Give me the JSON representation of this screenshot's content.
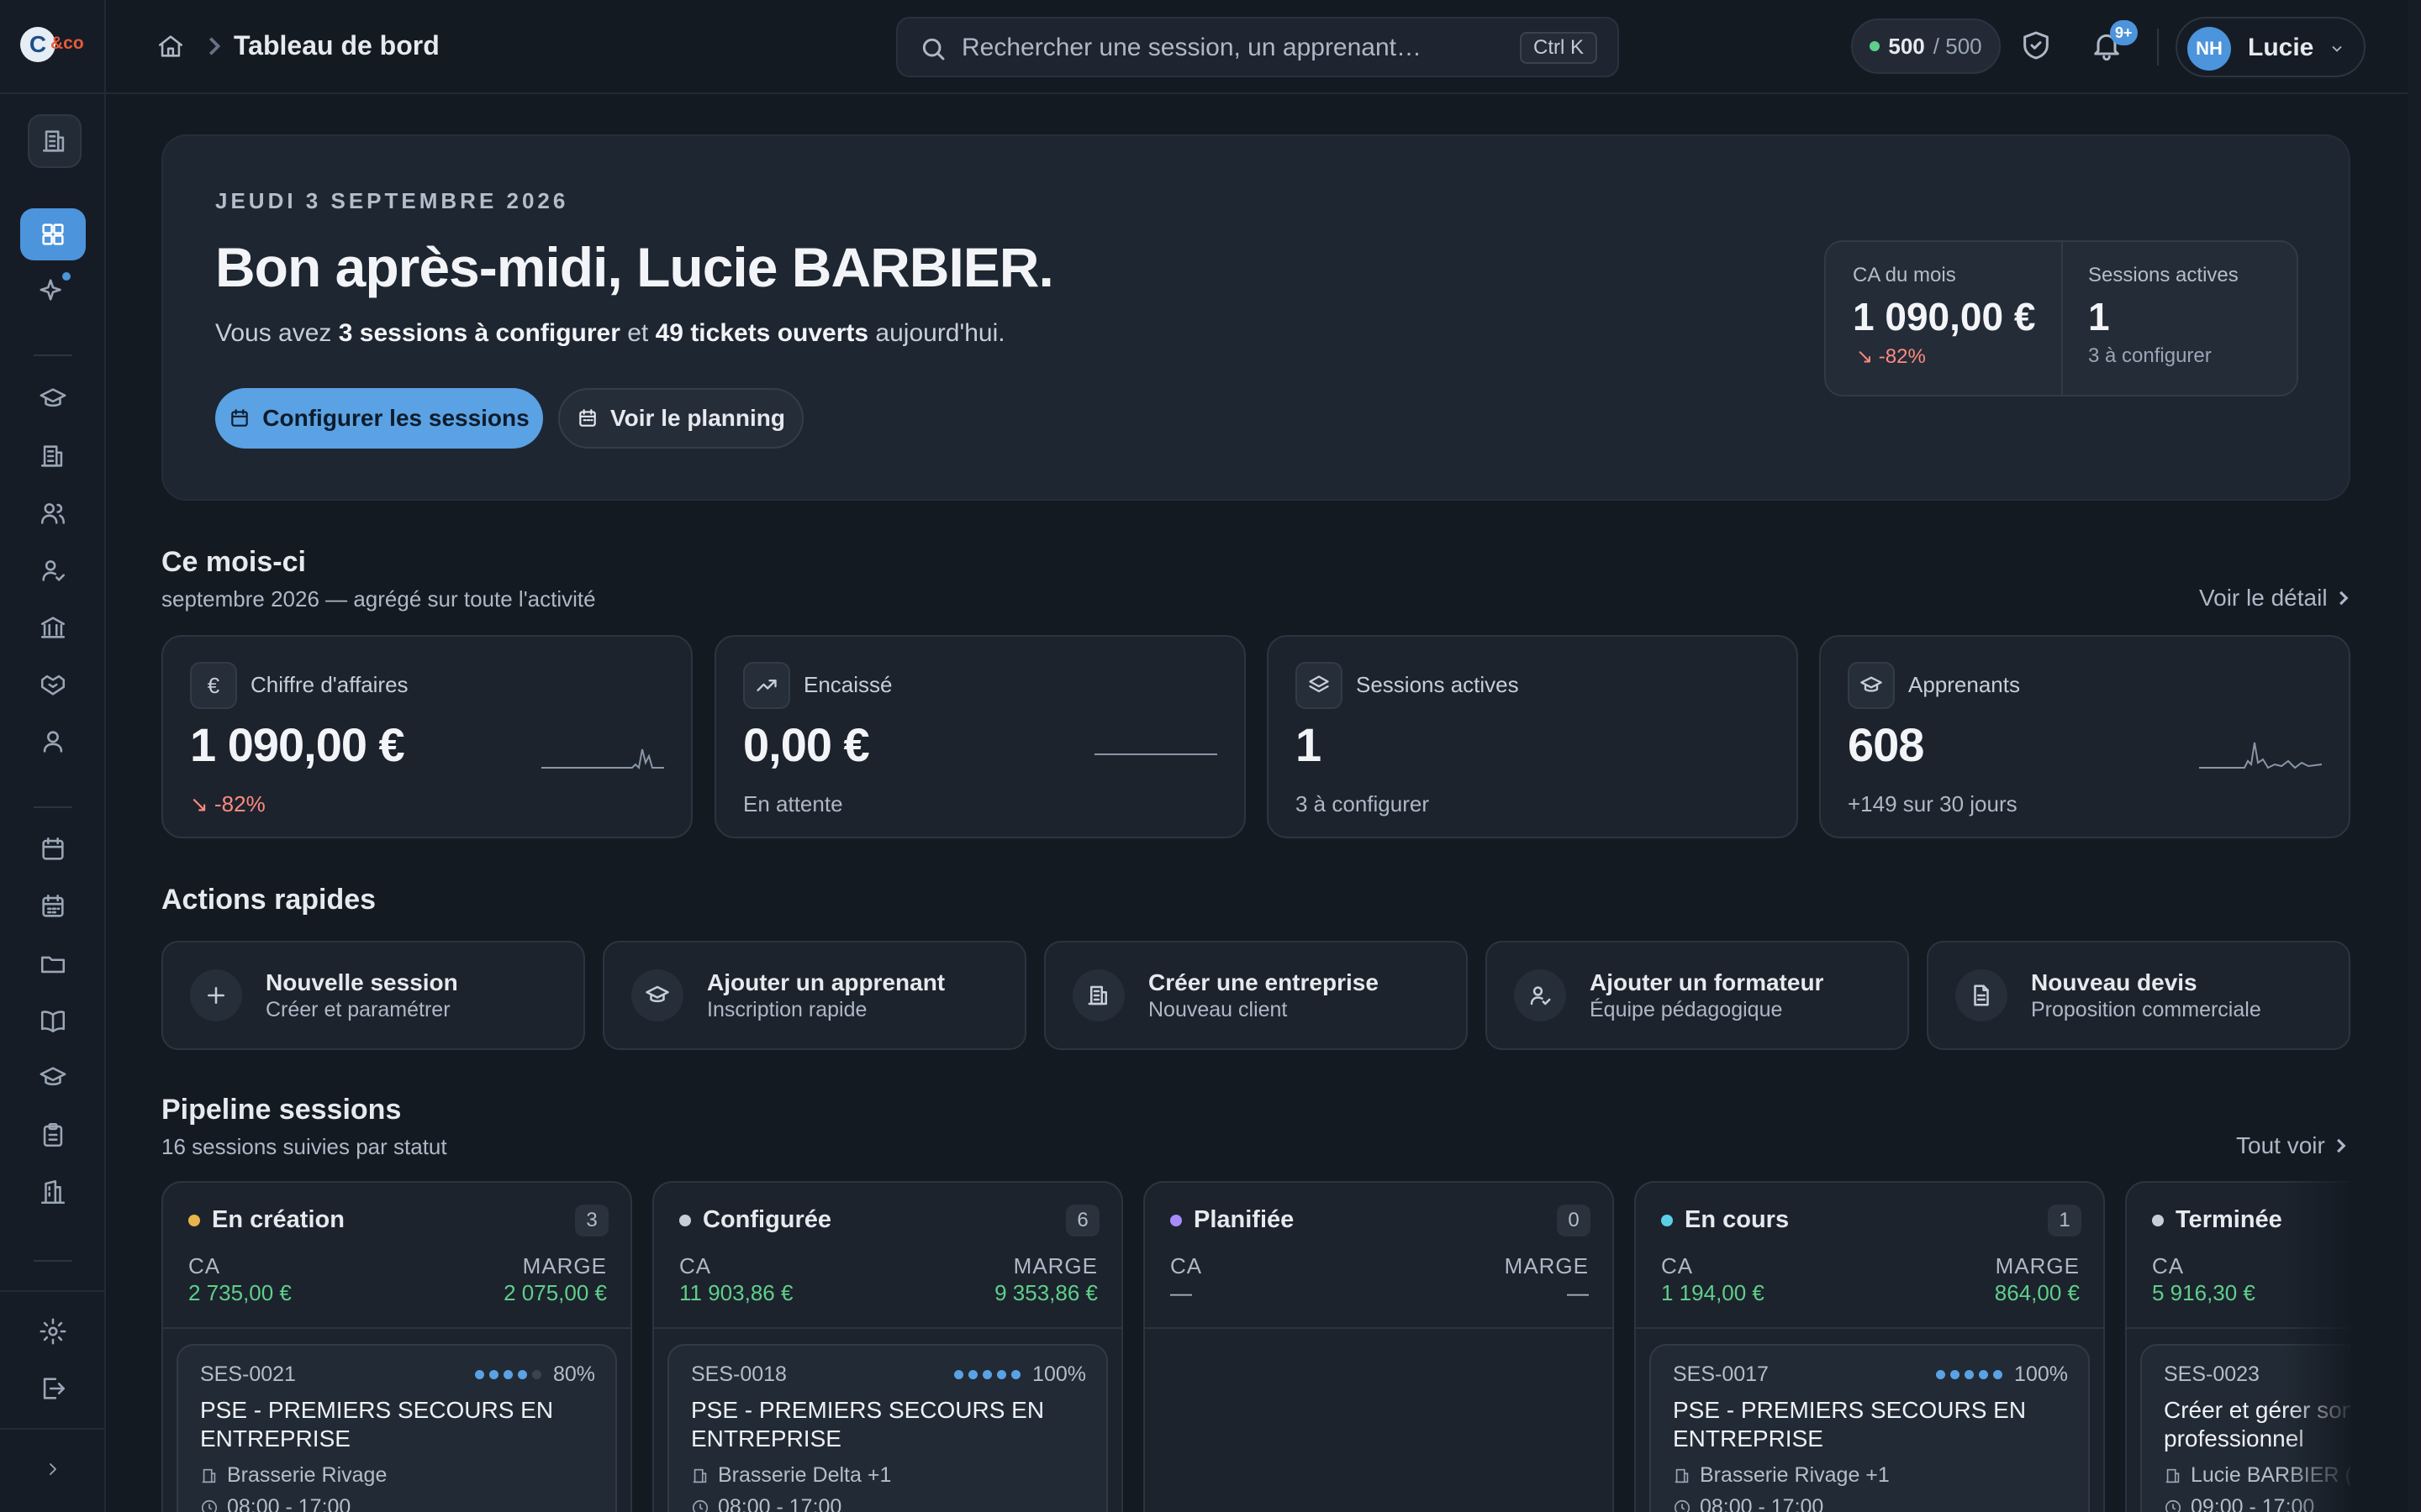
{
  "app": {
    "logo_letter": "C",
    "logo_suffix": "&co"
  },
  "topbar": {
    "breadcrumb_title": "Tableau de bord",
    "search_placeholder": "Rechercher une session, un apprenant…",
    "search_shortcut": "Ctrl K",
    "credits_used": "500",
    "credits_total": "/ 500",
    "notifications_badge": "9+",
    "user_initials": "NH",
    "user_name": "Lucie"
  },
  "hero": {
    "date": "JEUDI 3 SEPTEMBRE 2026",
    "greeting": "Bon après-midi, Lucie BARBIER.",
    "sub_prefix": "Vous avez ",
    "sub_bold1": "3 sessions à configurer",
    "sub_mid": " et ",
    "sub_bold2": "49 tickets ouverts",
    "sub_suffix": " aujourd'hui.",
    "btn_configure": "Configurer les sessions",
    "btn_planning": "Voir le planning",
    "stats": {
      "ca_label": "CA du mois",
      "ca_value": "1 090,00 €",
      "ca_trend": "↘ -82%",
      "sessions_label": "Sessions actives",
      "sessions_value": "1",
      "sessions_note": "3 à configurer"
    }
  },
  "month": {
    "title": "Ce mois-ci",
    "subtitle": "septembre 2026 — agrégé sur toute l'activité",
    "link": "Voir le détail",
    "kpis": [
      {
        "icon": "euro-icon",
        "glyph": "€",
        "label": "Chiffre d'affaires",
        "value": "1 090,00 €",
        "note": "↘ -82%"
      },
      {
        "icon": "trending-up-icon",
        "label": "Encaissé",
        "value": "0,00 €",
        "note": "En attente"
      },
      {
        "icon": "layers-icon",
        "label": "Sessions actives",
        "value": "1",
        "note": "3 à configurer"
      },
      {
        "icon": "graduation-cap-icon",
        "label": "Apprenants",
        "value": "608",
        "note": "+149 sur 30 jours"
      }
    ]
  },
  "quick_actions": {
    "title": "Actions rapides",
    "items": [
      {
        "icon": "plus-icon",
        "title": "Nouvelle session",
        "sub": "Créer et paramétrer"
      },
      {
        "icon": "graduation-cap-icon",
        "title": "Ajouter un apprenant",
        "sub": "Inscription rapide"
      },
      {
        "icon": "building-icon",
        "title": "Créer une entreprise",
        "sub": "Nouveau client"
      },
      {
        "icon": "user-check-icon",
        "title": "Ajouter un formateur",
        "sub": "Équipe pédagogique"
      },
      {
        "icon": "document-icon",
        "title": "Nouveau devis",
        "sub": "Proposition commerciale"
      }
    ]
  },
  "pipeline": {
    "title": "Pipeline sessions",
    "subtitle": "16 sessions suivies par statut",
    "link": "Tout voir",
    "ca_label": "CA",
    "marge_label": "MARGE",
    "columns": [
      {
        "name": "En création",
        "color": "#e8b44c",
        "count": "3",
        "ca": "2 735,00 €",
        "marge": "2 075,00 €",
        "card": {
          "ref": "SES-0021",
          "progress": 0.8,
          "progress_label": "80%",
          "title": "PSE - PREMIERS SECOURS EN ENTREPRISE",
          "org": "Brasserie Rivage",
          "time": "08:00 - 17:00"
        }
      },
      {
        "name": "Configurée",
        "color": "#c7ced9",
        "count": "6",
        "ca": "11 903,86 €",
        "marge": "9 353,86 €",
        "card": {
          "ref": "SES-0018",
          "progress": 1.0,
          "progress_label": "100%",
          "title": "PSE - PREMIERS SECOURS EN ENTREPRISE",
          "org": "Brasserie Delta  +1",
          "time": "08:00 - 17:00"
        }
      },
      {
        "name": "Planifiée",
        "color": "#a78bfa",
        "count": "0",
        "ca": "—",
        "marge": "—",
        "card": null
      },
      {
        "name": "En cours",
        "color": "#5ad0e8",
        "count": "1",
        "ca": "1 194,00 €",
        "marge": "864,00 €",
        "card": {
          "ref": "SES-0017",
          "progress": 1.0,
          "progress_label": "100%",
          "title": "PSE - PREMIERS SECOURS EN ENTREPRISE",
          "org": "Brasserie Rivage  +1",
          "time": "08:00 - 17:00"
        }
      },
      {
        "name": "Terminée",
        "color": "#c7ced9",
        "count": "",
        "ca": "5 916,30 €",
        "marge": "",
        "card": {
          "ref": "SES-0023",
          "progress": null,
          "progress_label": "",
          "title": "Créer et gérer son professionnel",
          "org": "Lucie BARBIER (",
          "time": "09:00 - 17:00"
        }
      }
    ]
  }
}
